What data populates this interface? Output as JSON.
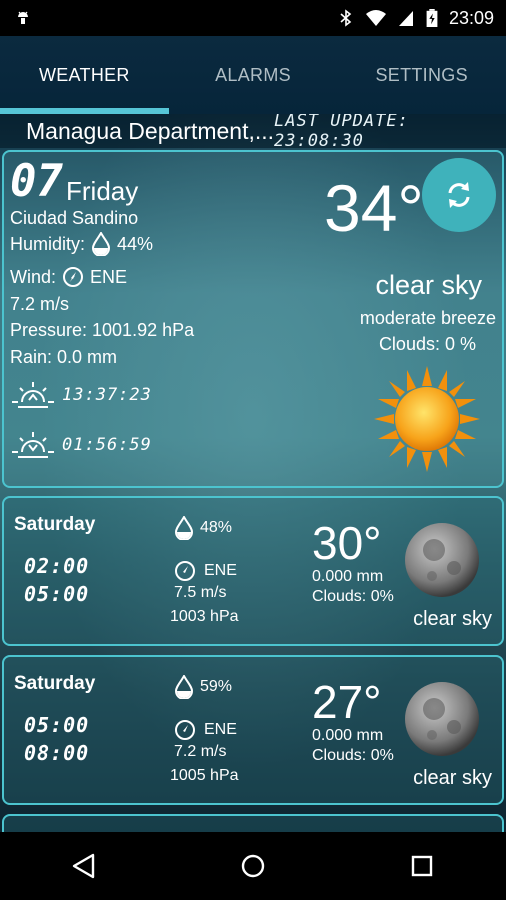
{
  "status_bar": {
    "time": "23:09",
    "icons": [
      "android-debug-icon",
      "bluetooth-icon",
      "wifi-icon",
      "cell-signal-icon",
      "battery-icon"
    ]
  },
  "tabs": [
    {
      "label": "WEATHER",
      "active": true
    },
    {
      "label": "ALARMS",
      "active": false
    },
    {
      "label": "SETTINGS",
      "active": false
    }
  ],
  "location_bar": {
    "location": "Managua Department,...",
    "last_update": "LAST UPDATE: 23:08:30"
  },
  "current": {
    "day_number": "07",
    "day_name": "Friday",
    "city": "Ciudad Sandino",
    "humidity_label": "Humidity:",
    "humidity_value": "44%",
    "wind_label": "Wind:",
    "wind_direction": "ENE",
    "wind_speed": "7.2 m/s",
    "pressure": "Pressure: 1001.92 hPa",
    "rain": "Rain: 0.0 mm",
    "sunrise": "13:37:23",
    "sunset": "01:56:59",
    "temperature": "34°",
    "condition": "clear sky",
    "wind_description": "moderate breeze",
    "clouds": "Clouds: 0 %",
    "condition_icon": "sun-icon"
  },
  "forecast": [
    {
      "day": "Saturday",
      "time_from": "02:00",
      "time_to": "05:00",
      "humidity": "48%",
      "wind_direction": "ENE",
      "wind_speed": "7.5 m/s",
      "pressure": "1003 hPa",
      "temperature": "30°",
      "rain": "0.000 mm",
      "clouds": "Clouds: 0%",
      "condition": "clear sky",
      "condition_icon": "moon-icon"
    },
    {
      "day": "Saturday",
      "time_from": "05:00",
      "time_to": "08:00",
      "humidity": "59%",
      "wind_direction": "ENE",
      "wind_speed": "7.2 m/s",
      "pressure": "1005 hPa",
      "temperature": "27°",
      "rain": "0.000 mm",
      "clouds": "Clouds: 0%",
      "condition": "clear sky",
      "condition_icon": "moon-icon"
    }
  ],
  "colors": {
    "accent": "#56c5d6",
    "card_border": "#4cc4cf",
    "refresh_button": "#3fb2bb"
  }
}
